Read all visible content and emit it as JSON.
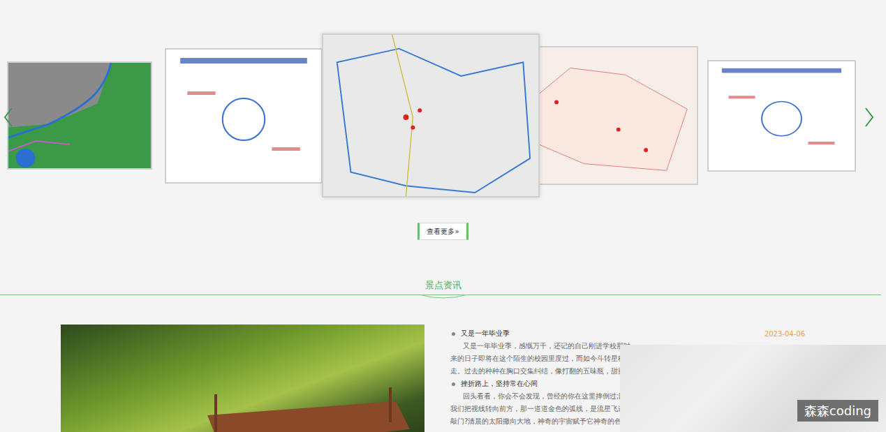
{
  "slides": [
    {
      "selected": false,
      "color": "#3a9a48"
    },
    {
      "selected": false,
      "color": "#ffffff"
    },
    {
      "selected": true,
      "color": "#e9e9e9"
    },
    {
      "selected": false,
      "color": "#f6efe9"
    },
    {
      "selected": false,
      "color": "#ffffff"
    }
  ],
  "more_button": "查看更多»",
  "section_title": "景点资讯",
  "date": "2023-04-06",
  "news": [
    {
      "title": "又是一年毕业季",
      "lines": [
        "又是一年毕业季，感慨万千，还记的自己刚进学校那时",
        "来的日子即将在这个陌生的校园里度过，而如今斗转星移，",
        "走。过去的种种在胸口交集纠结，像打翻的五味瓶，甜蜜，"
      ]
    },
    {
      "title": "挫折路上，坚持常在心间",
      "lines": [
        "回头看看，你会不会发现，曾经的你在这里摔倒过;回头",
        "我们把视线转向前方，那一道道金色的弧线，是流星飞逝的",
        "敲门?清晨的太阳撒向大地，神奇的宇宙赋予它神奇的色彩，"
      ]
    }
  ],
  "watermark": "森森coding"
}
